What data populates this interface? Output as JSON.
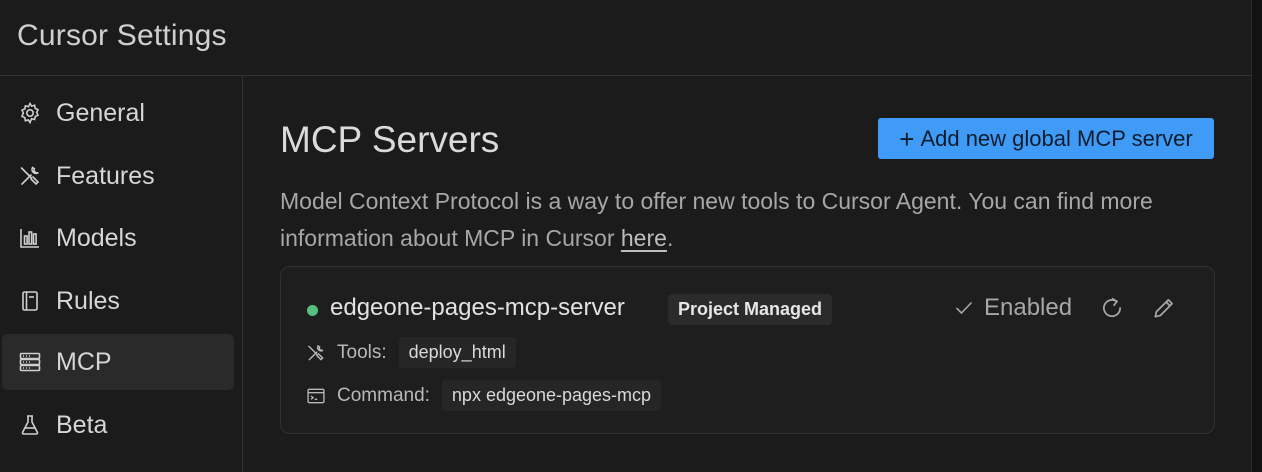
{
  "window": {
    "title": "Cursor Settings"
  },
  "sidebar": {
    "items": [
      {
        "label": "General",
        "icon": "gear-icon",
        "active": false
      },
      {
        "label": "Features",
        "icon": "tools-icon",
        "active": false
      },
      {
        "label": "Models",
        "icon": "bar-chart-icon",
        "active": false
      },
      {
        "label": "Rules",
        "icon": "book-icon",
        "active": false
      },
      {
        "label": "MCP",
        "icon": "server-icon",
        "active": true
      },
      {
        "label": "Beta",
        "icon": "flask-icon",
        "active": false
      }
    ]
  },
  "main": {
    "title": "MCP Servers",
    "add_button": {
      "plus": "+",
      "label": "Add new global MCP server"
    },
    "description": {
      "text": "Model Context Protocol is a way to offer new tools to Cursor Agent. You can find more information about MCP in Cursor ",
      "link": "here",
      "suffix": "."
    },
    "server": {
      "name": "edgeone-pages-mcp-server",
      "badge": "Project Managed",
      "status": "Enabled",
      "status_color": "#58c07e",
      "tools_label": "Tools:",
      "tools_value": "deploy_html",
      "command_label": "Command:",
      "command_value": "npx edgeone-pages-mcp"
    }
  },
  "colors": {
    "accent": "#3f9bf5",
    "background": "#1b1b1b"
  }
}
